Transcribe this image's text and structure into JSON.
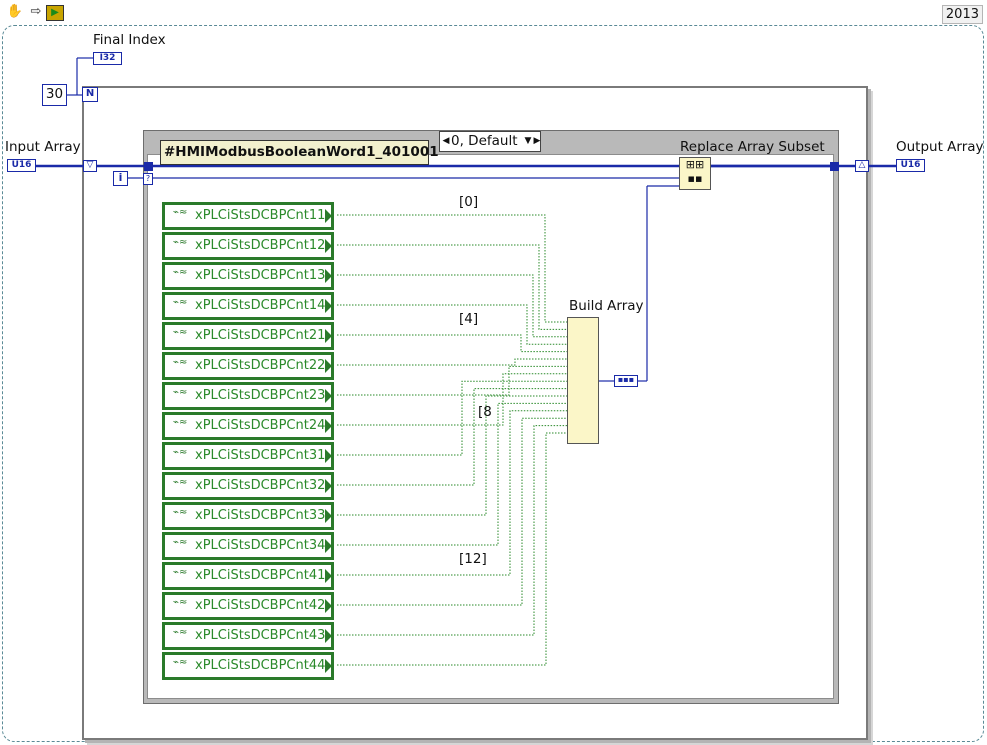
{
  "toolbar": {
    "hand_icon": "hand-icon",
    "arrow_icon": "arrow-icon",
    "run_icon": "run-icon",
    "version": "2013"
  },
  "diagram": {
    "final_index_label": "Final Index",
    "final_index_type": "I32",
    "loop_count": "30",
    "loop_count_terminal": "N",
    "iteration_terminal": "i",
    "input_array_label": "Input Array",
    "input_array_type": "U16",
    "output_array_label": "Output Array",
    "output_array_type": "U16",
    "case_selector": "0, Default",
    "property_node": "#HMIModbusBooleanWord1_401001",
    "replace_label": "Replace Array Subset",
    "build_array_label": "Build Array",
    "index_labels": [
      "[0]",
      "[4]",
      "[8",
      "[12]"
    ],
    "variables": [
      "xPLCiStsDCBPCnt11",
      "xPLCiStsDCBPCnt12",
      "xPLCiStsDCBPCnt13",
      "xPLCiStsDCBPCnt14",
      "xPLCiStsDCBPCnt21",
      "xPLCiStsDCBPCnt22",
      "xPLCiStsDCBPCnt23",
      "xPLCiStsDCBPCnt24",
      "xPLCiStsDCBPCnt31",
      "xPLCiStsDCBPCnt32",
      "xPLCiStsDCBPCnt33",
      "xPLCiStsDCBPCnt34",
      "xPLCiStsDCBPCnt41",
      "xPLCiStsDCBPCnt42",
      "xPLCiStsDCBPCnt43",
      "xPLCiStsDCBPCnt44"
    ],
    "colors": {
      "wire_blue": "#1a2aa8",
      "wire_green": "#2a8a2a",
      "frame_gray": "#b9b9b9",
      "node_yellow": "#fbf6c8"
    }
  }
}
